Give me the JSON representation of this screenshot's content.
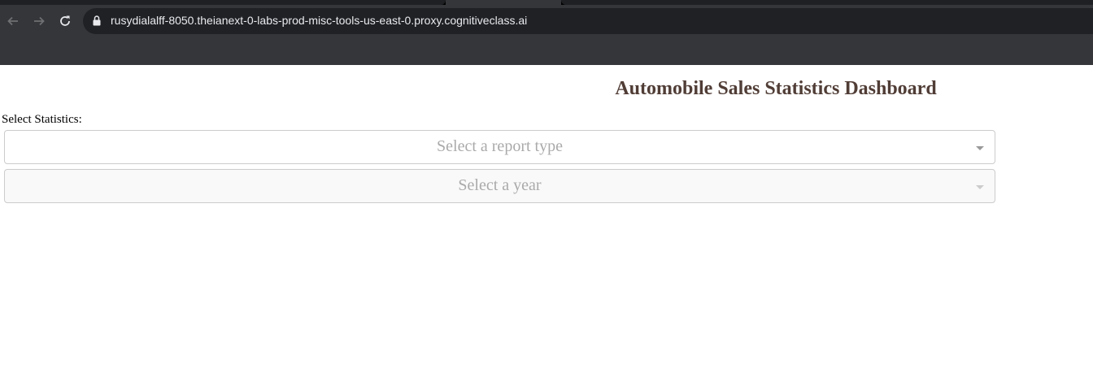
{
  "browser": {
    "url": "rusydialalff-8050.theianext-0-labs-prod-misc-tools-us-east-0.proxy.cognitiveclass.ai",
    "icons": [
      "back-arrow-icon",
      "forward-arrow-icon",
      "reload-icon",
      "lock-icon"
    ]
  },
  "page": {
    "title": "Automobile Sales Statistics Dashboard",
    "title_color": "#503d36",
    "select_label": "Select Statistics:",
    "report_dropdown": {
      "placeholder": "Select a report type",
      "disabled": false
    },
    "year_dropdown": {
      "placeholder": "Select a year",
      "disabled": true
    }
  }
}
